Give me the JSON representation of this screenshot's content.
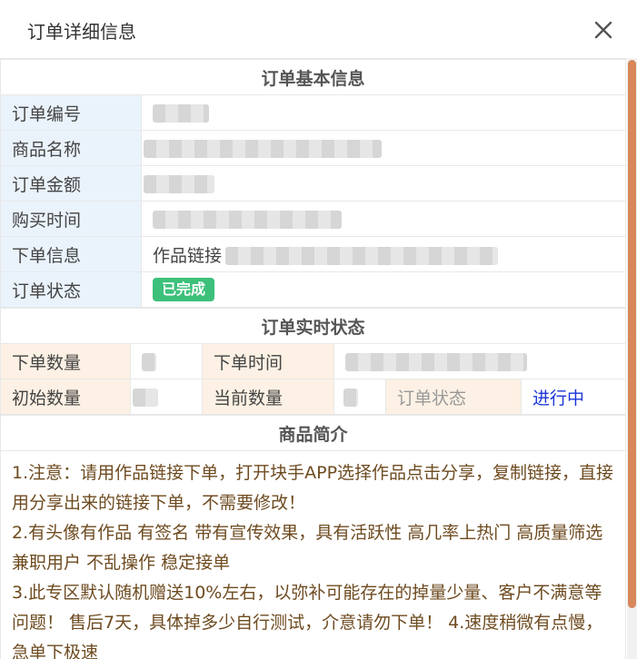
{
  "dialog": {
    "title": "订单详细信息"
  },
  "basic": {
    "section_title": "订单基本信息",
    "rows": [
      {
        "label": "订单编号"
      },
      {
        "label": "商品名称"
      },
      {
        "label": "订单金额"
      },
      {
        "label": "购买时间"
      },
      {
        "label": "下单信息",
        "prefix": "作品链接"
      },
      {
        "label": "订单状态",
        "badge": "已完成"
      }
    ]
  },
  "realtime": {
    "section_title": "订单实时状态",
    "qty_label": "下单数量",
    "time_label": "下单时间",
    "init_label": "初始数量",
    "current_label": "当前数量",
    "status_label": "订单状态",
    "status_value": "进行中"
  },
  "intro": {
    "section_title": "商品简介",
    "paragraphs": [
      "1.注意：请用作品链接下单，打开块手APP选择作品点击分享，复制链接，直接用分享出来的链接下单，不需要修改！",
      "2.有头像有作品 有签名 带有宣传效果，具有活跃性 高几率上热门 高质量筛选兼职用户 不乱操作 稳定接单",
      "3.此专区默认随机赠送10%左右，以弥补可能存在的掉量少量、客户不满意等问题！ 售后7天，具体掉多少自行测试，介意请勿下单！ 4.速度稍微有点慢，急单下极速"
    ]
  },
  "colors": {
    "badge": "#3cc07a",
    "status_running": "#1a35d8",
    "scrollbar": "#d9865a"
  }
}
